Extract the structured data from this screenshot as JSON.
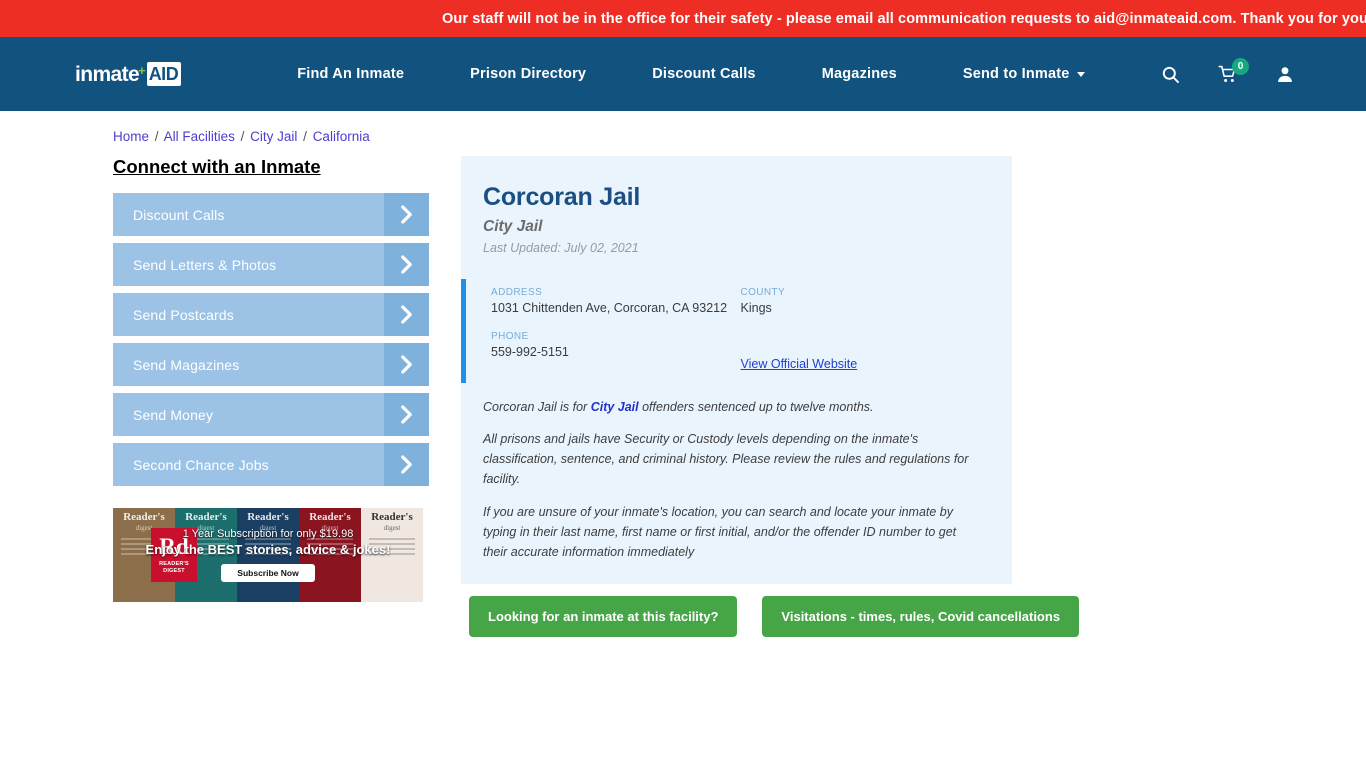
{
  "alert": {
    "message": "Our staff will not be in the office for their safety - please email all communication requests to aid@inmateaid.com. Thank you for your understanding.",
    "background": "#ee2d24"
  },
  "header": {
    "background": "#12527f",
    "logo": {
      "word": "inmate",
      "plus": "+",
      "aid": "AID"
    },
    "nav": [
      {
        "label": "Find An Inmate"
      },
      {
        "label": "Prison Directory"
      },
      {
        "label": "Discount Calls"
      },
      {
        "label": "Magazines"
      },
      {
        "label": "Send to Inmate",
        "dropdown": true
      }
    ],
    "actions": {
      "search_icon": "search-icon",
      "cart_icon": "cart-icon",
      "cart_count": "0",
      "cart_badge_color": "#14a97e",
      "account_icon": "user-icon"
    }
  },
  "breadcrumb": {
    "items": [
      "Home",
      "All Facilities",
      "City Jail",
      "California"
    ],
    "separator": "/"
  },
  "sidebar": {
    "title": "Connect with an Inmate",
    "items": [
      {
        "label": "Discount Calls"
      },
      {
        "label": "Send Letters & Photos"
      },
      {
        "label": "Send Postcards"
      },
      {
        "label": "Send Magazines"
      },
      {
        "label": "Send Money"
      },
      {
        "label": "Second Chance Jobs"
      }
    ],
    "button_color": "#9cc3e6",
    "arrow_color": "#7fb1dd"
  },
  "ad": {
    "brand": "Rd",
    "brand_sub": "READER'S DIGEST",
    "line1": "1 Year Subscription for only $19.98",
    "line2": "Enjoy the BEST stories, advice & jokes!",
    "cta": "Subscribe Now",
    "covers": [
      {
        "title": "Reader's",
        "sub": "digest"
      },
      {
        "title": "Reader's",
        "sub": "digest"
      },
      {
        "title": "Reader's",
        "sub": "digest"
      },
      {
        "title": "Reader's",
        "sub": "digest"
      },
      {
        "title": "Reader's",
        "sub": "digest"
      }
    ]
  },
  "facility": {
    "name": "Corcoran Jail",
    "type": "City Jail",
    "last_updated": "Last Updated: July 02, 2021",
    "card_background": "#e9f4fd",
    "accent_color": "#1f90e8",
    "info": {
      "address_label": "ADDRESS",
      "address_value": "1031 Chittenden Ave, Corcoran, CA 93212",
      "phone_label": "PHONE",
      "phone_value": "559-992-5151",
      "county_label": "COUNTY",
      "county_value": "Kings",
      "website_link": "View Official Website"
    },
    "paragraphs": {
      "p1_before": "Corcoran Jail is for ",
      "p1_link": "City Jail",
      "p1_after": " offenders sentenced up to twelve months.",
      "p2": "All prisons and jails have Security or Custody levels depending on the inmate's classification, sentence, and criminal history. Please review the rules and regulations for facility.",
      "p3": "If you are unsure of your inmate's location, you can search and locate your inmate by typing in their last name, first name or first initial, and/or the offender ID number to get their accurate information immediately"
    }
  },
  "cta": {
    "color": "#46a546",
    "buttons": [
      {
        "label": "Looking for an inmate at this facility?"
      },
      {
        "label": "Visitations - times, rules, Covid cancellations"
      }
    ]
  }
}
